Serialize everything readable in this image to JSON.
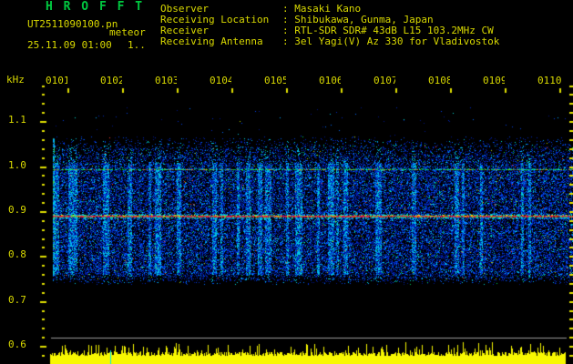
{
  "header": {
    "title": "H R O F F T",
    "filename": "UT2511090100.pn",
    "overlay_label": "meteor",
    "datetime": "25.11.09 01:00",
    "counter": "1..",
    "colon": ": ",
    "info": [
      {
        "label": "Observer",
        "value": "Masaki Kano"
      },
      {
        "label": "Receiving Location",
        "value": "Shibukawa, Gunma, Japan"
      },
      {
        "label": "Receiver",
        "value": "RTL-SDR SDR# 43dB L15 103.2MHz CW"
      },
      {
        "label": "Receiving Antenna",
        "value": "3el Yagi(V) Az 330 for Vladivostok"
      }
    ]
  },
  "chart_data": {
    "type": "heatmap",
    "title": "HROFFT 10-minute meteor-echo spectrogram with signal-strength strip",
    "x_axis": {
      "unit": "UT hhmm",
      "tick_labels": [
        "0101",
        "0102",
        "0103",
        "0104",
        "0105",
        "0106",
        "0107",
        "0108",
        "0109",
        "0110"
      ],
      "span_minutes": 10
    },
    "y_axis": {
      "unit": "kHz",
      "tick_labels": [
        "1.1",
        "1.0",
        "0.9",
        "0.8",
        "0.7",
        "0.6"
      ],
      "tick_values": [
        1.1,
        1.0,
        0.9,
        0.8,
        0.7,
        0.6
      ],
      "minor_step_khz": 0.02,
      "top_khz": 1.18,
      "bottom_khz": 0.58
    },
    "signals": {
      "carrier_line_khz": 0.89,
      "reference_line_khz": 0.993,
      "noise_band_khz": [
        0.74,
        1.06
      ],
      "noise_band_dense_khz": [
        0.77,
        1.0
      ],
      "vertical_streaks": "randomly spaced meteor-echo enhancements",
      "left_edge_bright_column": true
    },
    "strength_strip": {
      "description": "relative signal strength vs time, spiky yellow area plot",
      "baseline_gray_line": true,
      "cyan_marker_minute": 1.1
    },
    "legend": "none",
    "grid": "off"
  },
  "colors": {
    "background": "#000000",
    "text_yellow": "#d8d800",
    "title_green": "#00c840",
    "axis_tick_yellow": "#e0e000",
    "gray_line": "#9a9a9a",
    "strength_yellow": "#f8f800",
    "marker_cyan": "#00e8e8",
    "carrier_red": "#f01848",
    "reference_green": "#00c850",
    "noise_blue": "#0028c0"
  }
}
